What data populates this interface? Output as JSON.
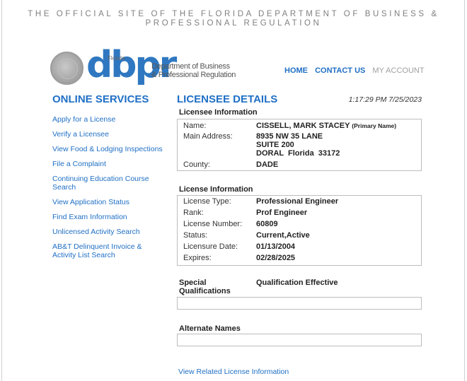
{
  "header": {
    "site_title_line1": "THE OFFICIAL SITE OF THE FLORIDA DEPARTMENT OF BUSINESS &",
    "site_title_line2": "PROFESSIONAL REGULATION",
    "logo_text": "dbpr",
    "logo_florida": "Florida",
    "dept_line1": "Department of Business",
    "dept_line2": "& Professional Regulation",
    "nav": [
      {
        "label": "HOME"
      },
      {
        "label": "CONTACT US"
      },
      {
        "label": "MY ACCOUNT"
      }
    ]
  },
  "sidebar": {
    "title": "ONLINE SERVICES",
    "items": [
      {
        "label": "Apply for a License"
      },
      {
        "label": "Verify a Licensee"
      },
      {
        "label": "View Food & Lodging Inspections"
      },
      {
        "label": "File a Complaint"
      },
      {
        "label": "Continuing Education Course Search"
      },
      {
        "label": "View Application Status"
      },
      {
        "label": "Find Exam Information"
      },
      {
        "label": "Unlicensed Activity Search"
      },
      {
        "label": "AB&T Delinquent Invoice & Activity List Search"
      }
    ]
  },
  "main": {
    "title": "LICENSEE DETAILS",
    "timestamp": "1:17:29 PM 7/25/2023",
    "licensee": {
      "section_label": "Licensee Information",
      "name_label": "Name:",
      "name_value": "CISSELL, MARK STACEY",
      "name_tag": "(Primary Name)",
      "address_label": "Main Address:",
      "address_line1": "8935 NW 35 LANE",
      "address_line2": "SUITE 200",
      "address_line3": "DORAL  Florida  33172",
      "county_label": "County:",
      "county_value": "DADE"
    },
    "license": {
      "section_label": "License Information",
      "rows": [
        {
          "label": "License Type:",
          "value": "Professional Engineer"
        },
        {
          "label": "Rank:",
          "value": "Prof Engineer"
        },
        {
          "label": "License Number:",
          "value": "60809"
        },
        {
          "label": "Status:",
          "value": "Current,Active"
        },
        {
          "label": "Licensure Date:",
          "value": "01/13/2004"
        },
        {
          "label": "Expires:",
          "value": "02/28/2025"
        }
      ]
    },
    "special_qual_label": "Special Qualifications",
    "qual_effective_label": "Qualification Effective",
    "alternate_names_label": "Alternate Names",
    "related_link": "View Related License Information"
  }
}
